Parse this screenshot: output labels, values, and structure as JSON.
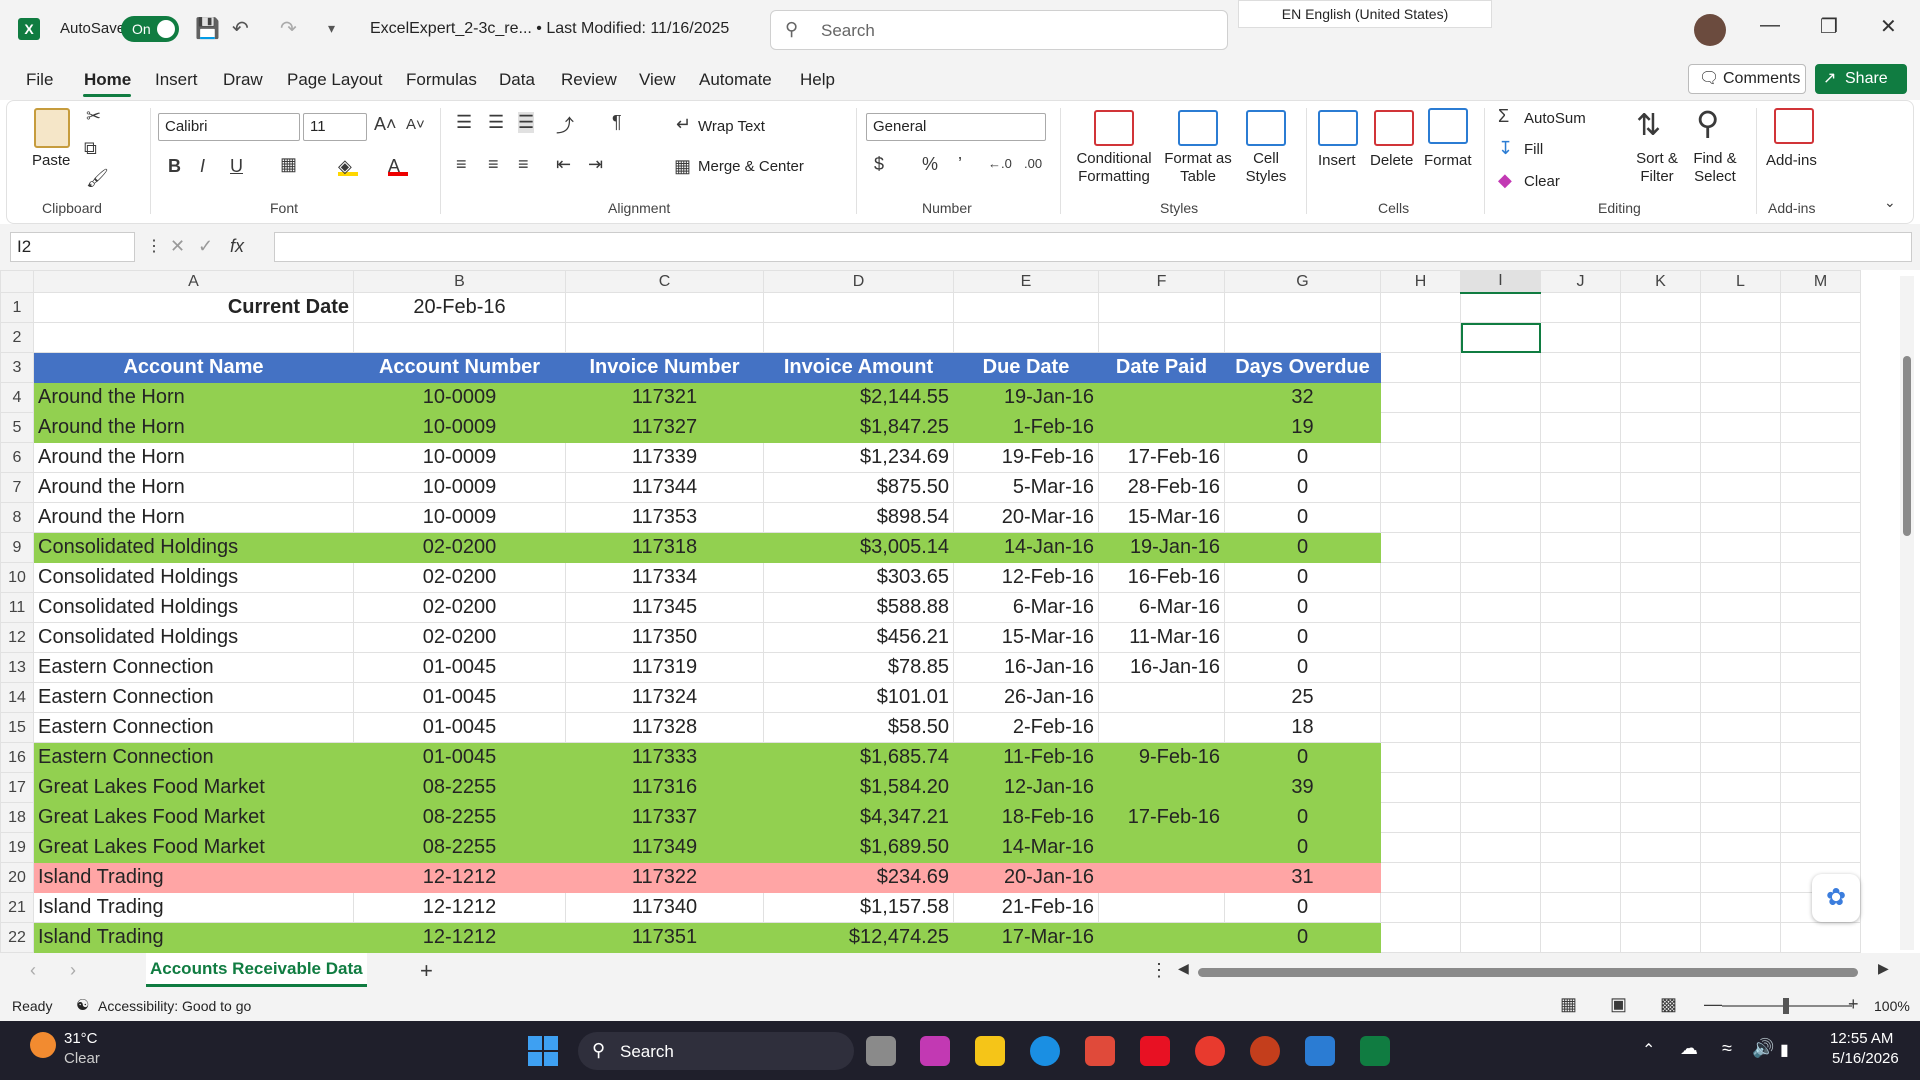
{
  "title_bar": {
    "autosave_label": "AutoSave",
    "autosave_state": "On",
    "doc_title": "ExcelExpert_2-3c_re...  •  Last Modified: 11/16/2025",
    "search_placeholder": "Search",
    "language": "EN English (United States)"
  },
  "menu": [
    "File",
    "Home",
    "Insert",
    "Draw",
    "Page Layout",
    "Formulas",
    "Data",
    "Review",
    "View",
    "Automate",
    "Help"
  ],
  "menu_active": "Home",
  "buttons": {
    "comments": "Comments",
    "share": "Share"
  },
  "ribbon": {
    "clipboard": {
      "paste": "Paste",
      "label": "Clipboard"
    },
    "font": {
      "name": "Calibri",
      "size": "11",
      "label": "Font"
    },
    "alignment": {
      "wrap": "Wrap Text",
      "merge": "Merge & Center",
      "label": "Alignment"
    },
    "number": {
      "format": "General",
      "label": "Number"
    },
    "styles": {
      "conditional": [
        "Conditional",
        "Formatting"
      ],
      "format_table": [
        "Format as",
        "Table"
      ],
      "cell_styles": [
        "Cell",
        "Styles"
      ],
      "label": "Styles"
    },
    "cells": {
      "insert": "Insert",
      "delete": "Delete",
      "format": "Format",
      "label": "Cells"
    },
    "editing": {
      "autosum": "AutoSum",
      "fill": "Fill",
      "clear": "Clear",
      "sort": [
        "Sort &",
        "Filter"
      ],
      "find": [
        "Find &",
        "Select"
      ],
      "label": "Editing"
    },
    "addins": {
      "addins": "Add-ins",
      "label": "Add-ins"
    }
  },
  "formula_bar": {
    "name_box": "I2",
    "fx": "fx",
    "content": ""
  },
  "columns": [
    "A",
    "B",
    "C",
    "D",
    "E",
    "F",
    "G",
    "H",
    "I",
    "J",
    "K",
    "L",
    "M"
  ],
  "sheet": {
    "current_date_label": "Current Date",
    "current_date_value": "20-Feb-16",
    "headers": [
      "Account Name",
      "Account Number",
      "Invoice Number",
      "Invoice Amount",
      "Due Date",
      "Date Paid",
      "Days Overdue"
    ],
    "rows": [
      {
        "n": "4",
        "fill": "green",
        "cells": [
          "Around the Horn",
          "10-0009",
          "117321",
          "$2,144.55",
          "19-Jan-16",
          "",
          "32"
        ]
      },
      {
        "n": "5",
        "fill": "green",
        "cells": [
          "Around the Horn",
          "10-0009",
          "117327",
          "$1,847.25",
          "1-Feb-16",
          "",
          "19"
        ]
      },
      {
        "n": "6",
        "fill": "none",
        "cells": [
          "Around the Horn",
          "10-0009",
          "117339",
          "$1,234.69",
          "19-Feb-16",
          "17-Feb-16",
          "0"
        ]
      },
      {
        "n": "7",
        "fill": "none",
        "cells": [
          "Around the Horn",
          "10-0009",
          "117344",
          "$875.50",
          "5-Mar-16",
          "28-Feb-16",
          "0"
        ]
      },
      {
        "n": "8",
        "fill": "none",
        "cells": [
          "Around the Horn",
          "10-0009",
          "117353",
          "$898.54",
          "20-Mar-16",
          "15-Mar-16",
          "0"
        ]
      },
      {
        "n": "9",
        "fill": "green",
        "cells": [
          "Consolidated Holdings",
          "02-0200",
          "117318",
          "$3,005.14",
          "14-Jan-16",
          "19-Jan-16",
          "0"
        ]
      },
      {
        "n": "10",
        "fill": "none",
        "cells": [
          "Consolidated Holdings",
          "02-0200",
          "117334",
          "$303.65",
          "12-Feb-16",
          "16-Feb-16",
          "0"
        ]
      },
      {
        "n": "11",
        "fill": "none",
        "cells": [
          "Consolidated Holdings",
          "02-0200",
          "117345",
          "$588.88",
          "6-Mar-16",
          "6-Mar-16",
          "0"
        ]
      },
      {
        "n": "12",
        "fill": "none",
        "cells": [
          "Consolidated Holdings",
          "02-0200",
          "117350",
          "$456.21",
          "15-Mar-16",
          "11-Mar-16",
          "0"
        ]
      },
      {
        "n": "13",
        "fill": "none",
        "cells": [
          "Eastern Connection",
          "01-0045",
          "117319",
          "$78.85",
          "16-Jan-16",
          "16-Jan-16",
          "0"
        ]
      },
      {
        "n": "14",
        "fill": "none",
        "cells": [
          "Eastern Connection",
          "01-0045",
          "117324",
          "$101.01",
          "26-Jan-16",
          "",
          "25"
        ]
      },
      {
        "n": "15",
        "fill": "none",
        "cells": [
          "Eastern Connection",
          "01-0045",
          "117328",
          "$58.50",
          "2-Feb-16",
          "",
          "18"
        ]
      },
      {
        "n": "16",
        "fill": "green",
        "cells": [
          "Eastern Connection",
          "01-0045",
          "117333",
          "$1,685.74",
          "11-Feb-16",
          "9-Feb-16",
          "0"
        ]
      },
      {
        "n": "17",
        "fill": "green",
        "cells": [
          "Great Lakes Food Market",
          "08-2255",
          "117316",
          "$1,584.20",
          "12-Jan-16",
          "",
          "39"
        ]
      },
      {
        "n": "18",
        "fill": "green",
        "cells": [
          "Great Lakes Food Market",
          "08-2255",
          "117337",
          "$4,347.21",
          "18-Feb-16",
          "17-Feb-16",
          "0"
        ]
      },
      {
        "n": "19",
        "fill": "green",
        "cells": [
          "Great Lakes Food Market",
          "08-2255",
          "117349",
          "$1,689.50",
          "14-Mar-16",
          "",
          "0"
        ]
      },
      {
        "n": "20",
        "fill": "pink",
        "cells": [
          "Island Trading",
          "12-1212",
          "117322",
          "$234.69",
          "20-Jan-16",
          "",
          "31"
        ]
      },
      {
        "n": "21",
        "fill": "none",
        "cells": [
          "Island Trading",
          "12-1212",
          "117340",
          "$1,157.58",
          "21-Feb-16",
          "",
          "0"
        ]
      },
      {
        "n": "22",
        "fill": "green",
        "cells": [
          "Island Trading",
          "12-1212",
          "117351",
          "$12,474.25",
          "17-Mar-16",
          "",
          "0"
        ]
      }
    ]
  },
  "sheet_tab": "Accounts Receivable Data",
  "status": {
    "ready": "Ready",
    "accessibility": "Accessibility: Good to go",
    "zoom": "100%"
  },
  "taskbar": {
    "temp": "31°C",
    "weather": "Clear",
    "search": "Search",
    "time": "12:55 AM",
    "date": "5/16/2026"
  },
  "colors": {
    "excel_green": "#107c41",
    "header_blue": "#4472c4",
    "row_green": "#92d050",
    "row_pink": "#ffa5a5"
  }
}
